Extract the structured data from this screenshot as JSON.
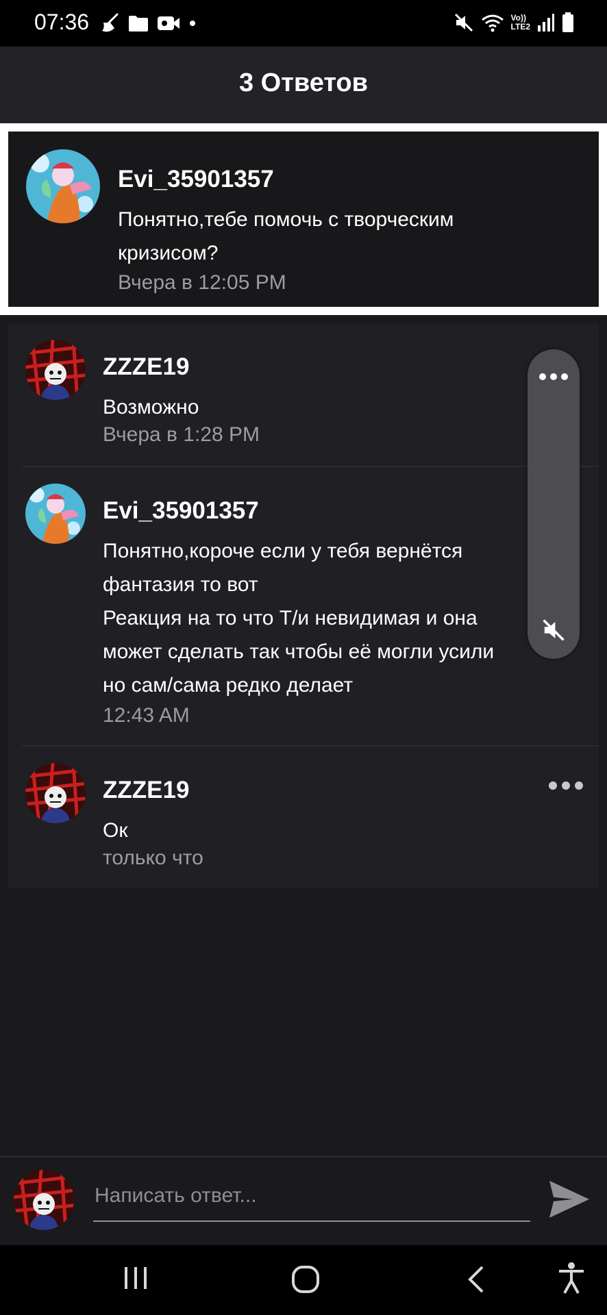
{
  "status_bar": {
    "time": "07:36",
    "left_icons": [
      "broom-icon",
      "folder-icon",
      "video-camera-icon",
      "dot-icon"
    ],
    "right_icons": [
      "mute-icon",
      "wifi-icon",
      "volte-icon",
      "signal-icon",
      "battery-icon"
    ],
    "volte_label_top": "Vo))",
    "volte_label_bottom": "LTE2"
  },
  "header": {
    "title": "3 Ответов"
  },
  "parent_comment": {
    "author": "Evi_35901357",
    "text_line1": "Понятно,тебе помочь с творческим",
    "text_line2": "кризисом?",
    "time": "Вчера в 12:05 PM"
  },
  "replies": [
    {
      "author": "ZZZE19",
      "lines": [
        "Возможно"
      ],
      "time": "Вчера в 1:28 PM"
    },
    {
      "author": "Evi_35901357",
      "lines": [
        "Понятно,короче если у тебя вернётся",
        "фантазия то вот",
        "Реакция на то что Т/и невидимая и она",
        "может сделать так чтобы её могли усили",
        "но сам/сама редко делает"
      ],
      "time": "12:43 AM"
    },
    {
      "author": "ZZZE19",
      "lines": [
        "Ок"
      ],
      "time": "только что"
    }
  ],
  "composer": {
    "placeholder": "Написать ответ..."
  },
  "colors": {
    "background": "#1a191c",
    "header": "#232226",
    "card": "#201f23",
    "secondary_text": "#9d9ca1"
  }
}
